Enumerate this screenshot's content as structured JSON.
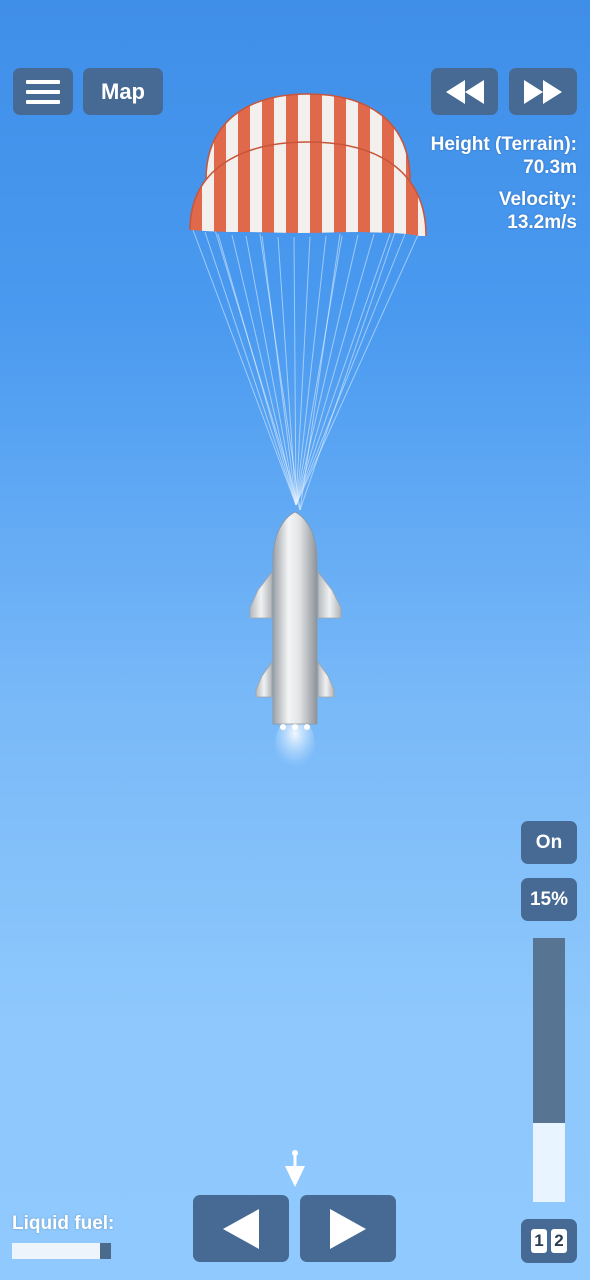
{
  "toolbar": {
    "menu_icon": "hamburger-icon",
    "map_label": "Map",
    "rewind_icon": "rewind-icon",
    "fast_forward_icon": "fast-forward-icon"
  },
  "telemetry": {
    "height_label": "Height (Terrain):",
    "height_value": "70.3m",
    "velocity_label": "Velocity:",
    "velocity_value": "13.2m/s"
  },
  "controls": {
    "engine_toggle_label": "On",
    "throttle_label": "15%",
    "throttle_fraction": 0.3,
    "stage_numbers": [
      "1",
      "2"
    ],
    "rotate_left_icon": "left-arrow-icon",
    "rotate_right_icon": "right-arrow-icon"
  },
  "fuel": {
    "label": "Liquid fuel:",
    "fraction": 0.89
  },
  "colors": {
    "button_bg": "#466a93",
    "parachute_red": "#e0694c",
    "parachute_white": "#f3efec"
  }
}
